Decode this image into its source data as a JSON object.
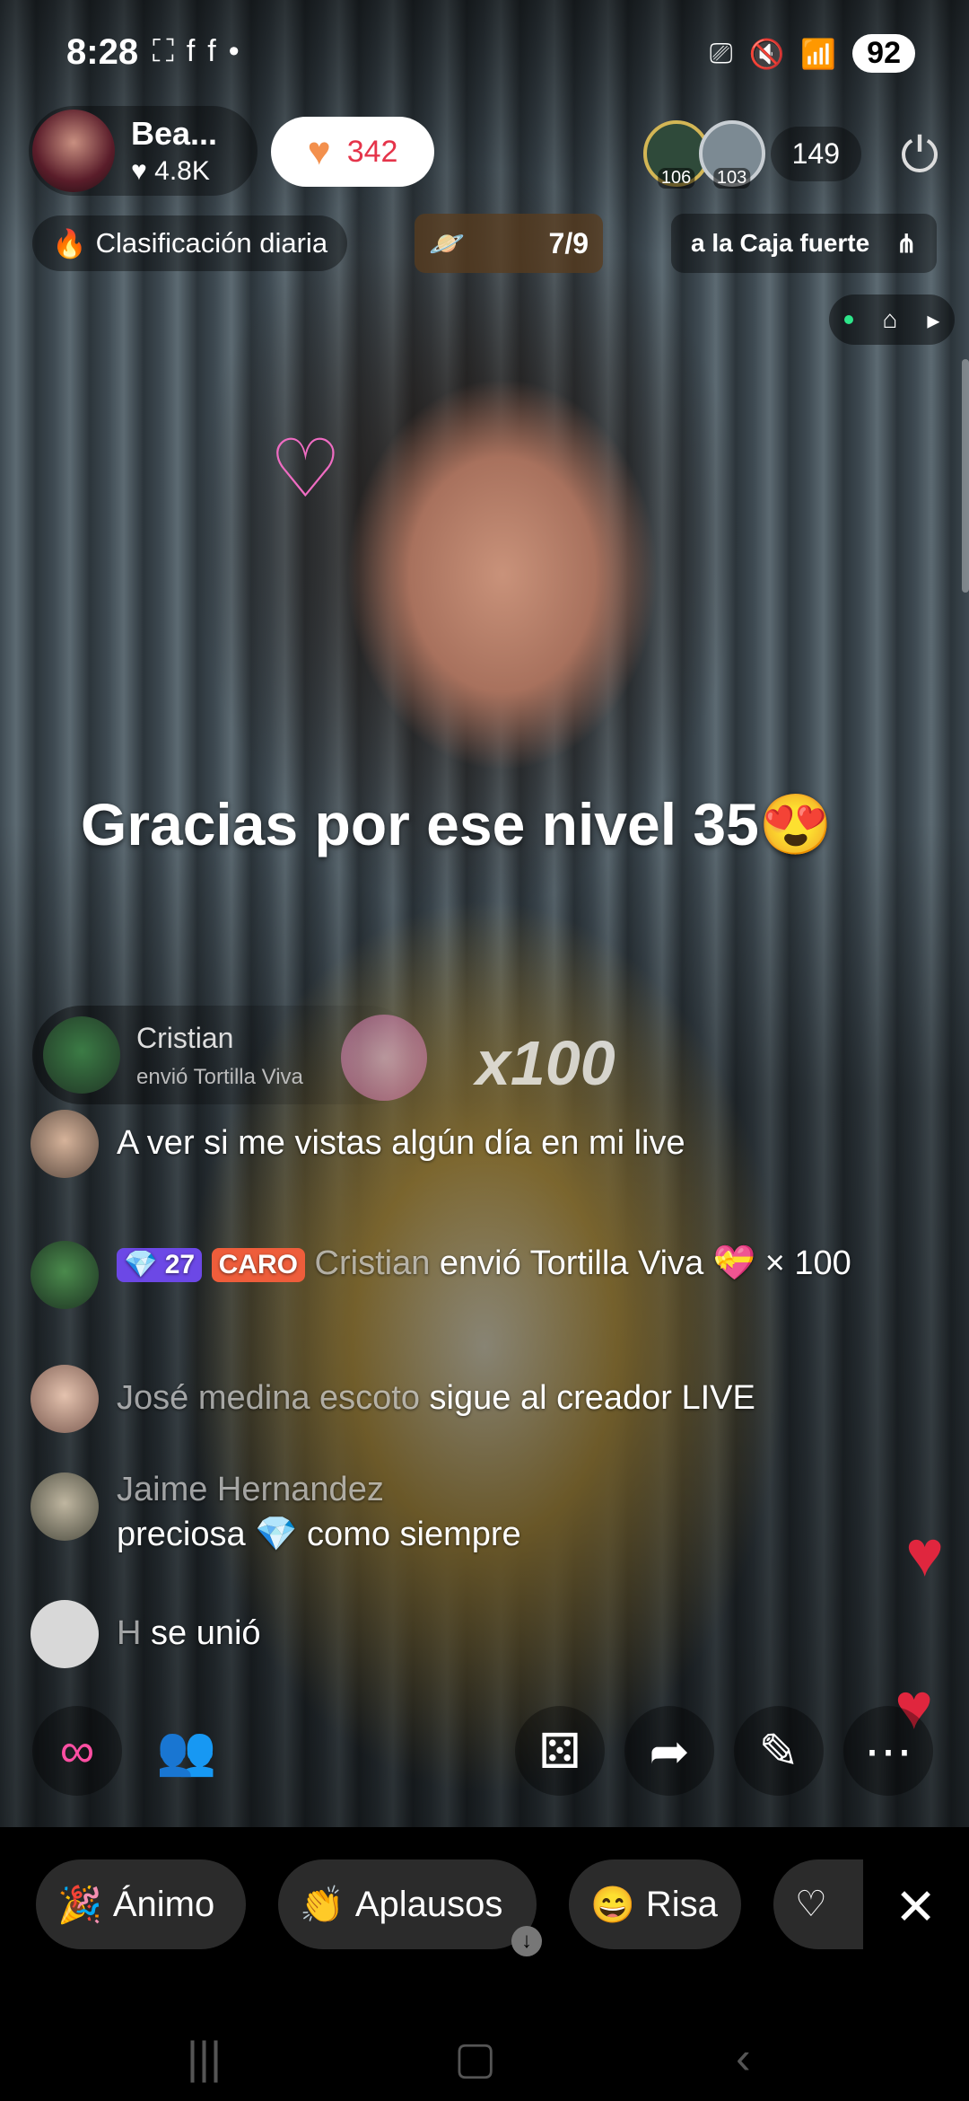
{
  "status_bar": {
    "time": "8:28",
    "left_icons": [
      "⛶",
      "f",
      "f",
      "•"
    ],
    "battery": "92"
  },
  "host": {
    "name": "Bea...",
    "likes": "♥ 4.8K",
    "follow_count": "342"
  },
  "viewers": {
    "badges": [
      "106",
      "103"
    ],
    "count": "149"
  },
  "info_bar": {
    "ranking": "Clasificación diaria",
    "goal": "7/9",
    "vault": "a la Caja fuerte"
  },
  "overlay": {
    "caption": "Gracias por ese nivel 35😍"
  },
  "gift_banner": {
    "name": "Cristian",
    "subtitle": "envió Tortilla Viva",
    "multiplier": "x100"
  },
  "chat": [
    {
      "text": "A ver si me vistas algún día en mi live"
    },
    {
      "badge_level": "27",
      "badge_fan": "CARO",
      "user": "Cristian",
      "text": " envió Tortilla Viva 💝 × 100"
    },
    {
      "user": "José medina escoto",
      "text": " sigue al creador LIVE"
    },
    {
      "user": "Jaime Hernandez",
      "text": "preciosa 💎 como siempre"
    },
    {
      "user": "H",
      "text": " se unió"
    }
  ],
  "reactions": [
    {
      "icon": "🎉",
      "label": "Ánimo"
    },
    {
      "icon": "👏",
      "label": "Aplausos"
    },
    {
      "icon": "😄",
      "label": "Risa"
    },
    {
      "icon": "♡",
      "label": ""
    }
  ],
  "accent_colors": {
    "like_red": "#e5344a",
    "heart_orange": "#f3904d",
    "float_heart": "#e0263e"
  }
}
